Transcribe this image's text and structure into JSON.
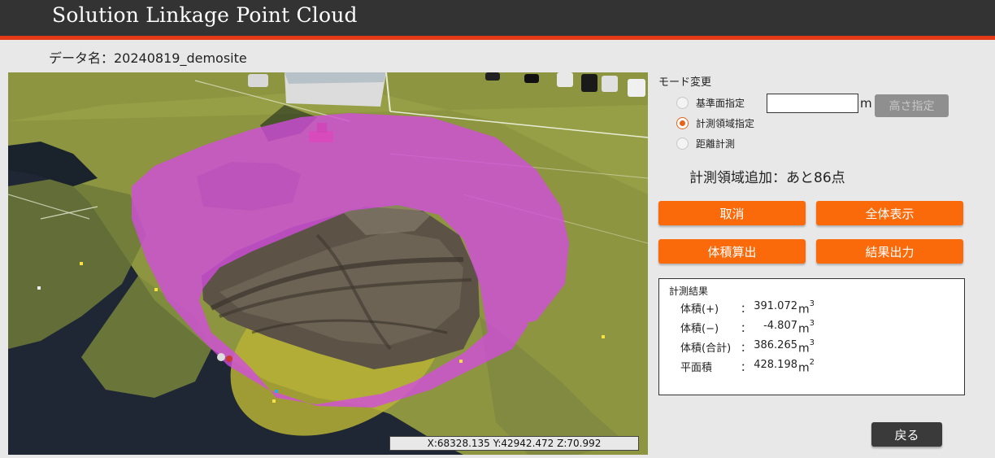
{
  "app": {
    "title": "Solution Linkage Point Cloud"
  },
  "data_name": "データ名：20240819_demosite",
  "viewer": {
    "coordinates": "X:68328.135 Y:42942.472 Z:70.992"
  },
  "mode": {
    "label": "モード変更",
    "options": [
      {
        "label": "基準面指定",
        "checked": false
      },
      {
        "label": "計測領域指定",
        "checked": true
      },
      {
        "label": "距離計測",
        "checked": false
      }
    ],
    "height_input_value": "",
    "height_unit": "m",
    "height_button": "高さ指定"
  },
  "status": {
    "remaining": "計測領域追加：あと86点"
  },
  "buttons": {
    "cancel": "取消",
    "show_all": "全体表示",
    "compute_volume": "体積算出",
    "export_results": "結果出力",
    "back": "戻る"
  },
  "results": {
    "title": "計測結果",
    "rows": [
      {
        "label": "体積(+)",
        "value": "391.072",
        "unit": "m",
        "exp": "3"
      },
      {
        "label": "体積(−)",
        "value": "-4.807",
        "unit": "m",
        "exp": "3"
      },
      {
        "label": "体積(合計)",
        "value": "386.265",
        "unit": "m",
        "exp": "3"
      },
      {
        "label": "平面積",
        "value": "428.198",
        "unit": "m",
        "exp": "2"
      }
    ]
  },
  "colors": {
    "accent_orange": "#fb6a0a",
    "header_bg": "#333333",
    "header_rule": "#e63a16",
    "selection_magenta": "#d44be0"
  },
  "icons": [
    "radio-icon"
  ]
}
